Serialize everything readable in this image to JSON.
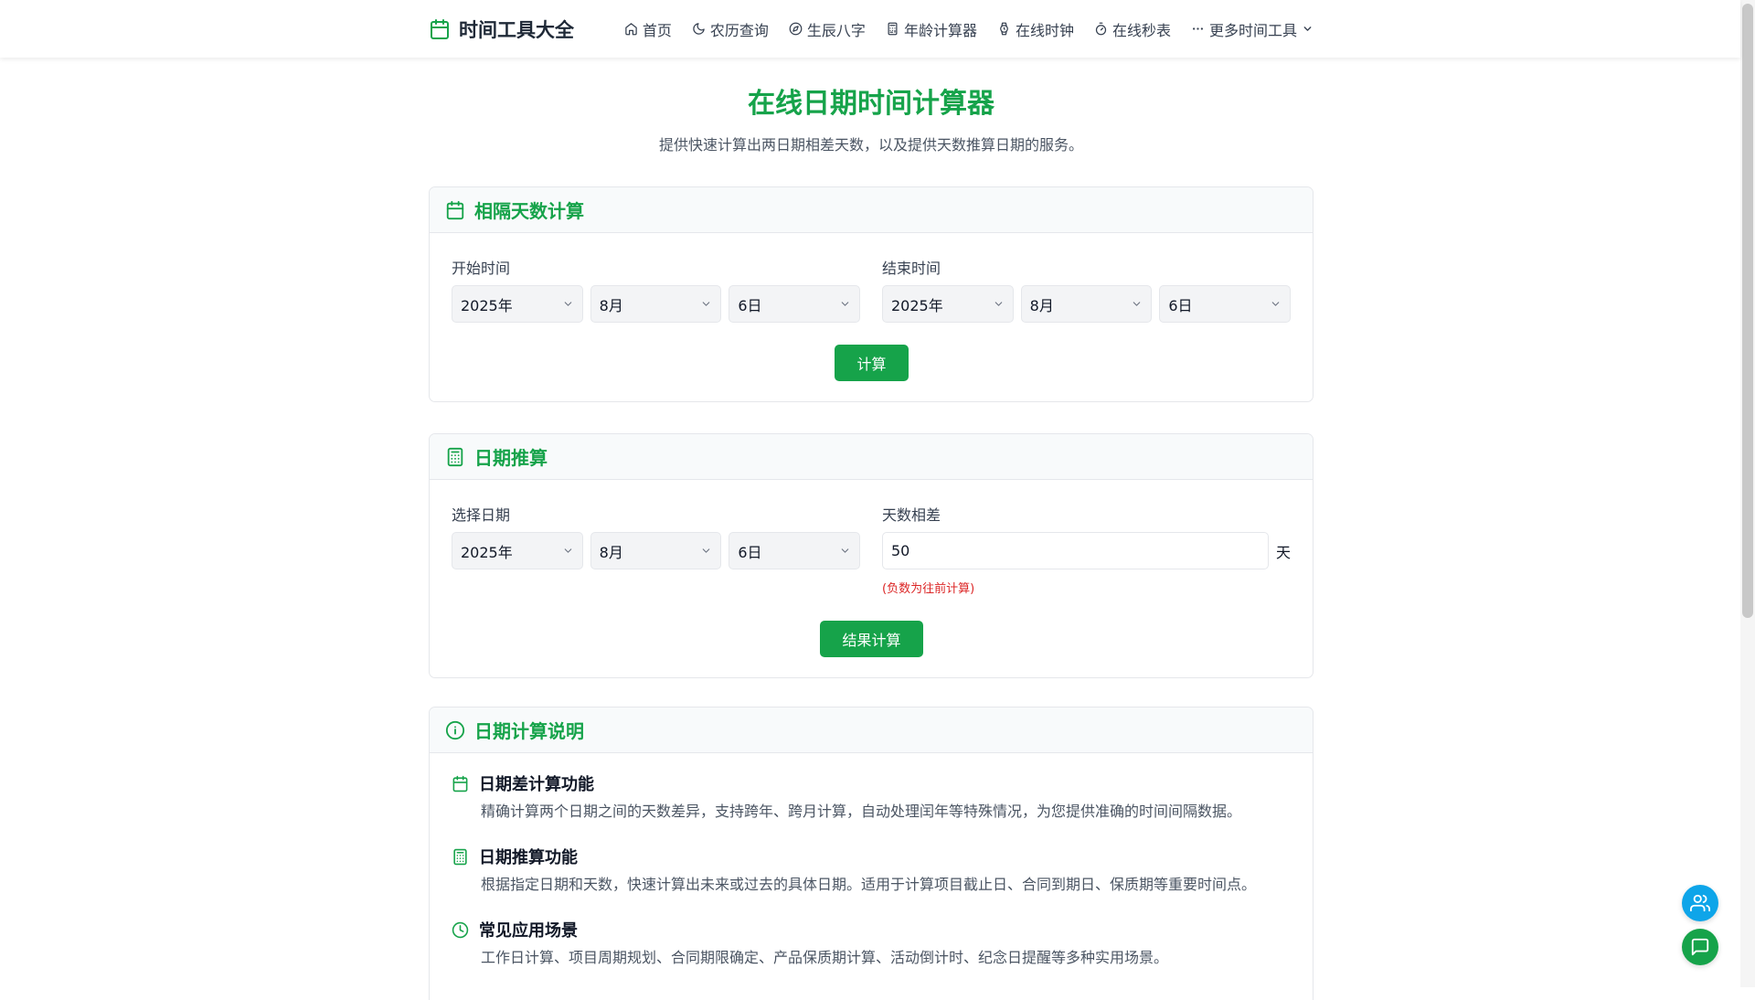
{
  "header": {
    "brand": "时间工具大全",
    "nav": [
      {
        "label": "首页",
        "icon": "home-icon"
      },
      {
        "label": "农历查询",
        "icon": "moon-icon"
      },
      {
        "label": "生辰八字",
        "icon": "compass-icon"
      },
      {
        "label": "年龄计算器",
        "icon": "calculator-icon"
      },
      {
        "label": "在线时钟",
        "icon": "watch-icon"
      },
      {
        "label": "在线秒表",
        "icon": "stopwatch-icon"
      }
    ],
    "more": "更多时间工具"
  },
  "page": {
    "title": "在线日期时间计算器",
    "subtitle": "提供快速计算出两日期相差天数，以及提供天数推算日期的服务。"
  },
  "diff_card": {
    "title": "相隔天数计算",
    "start_label": "开始时间",
    "start": {
      "year": "2025年",
      "month": "8月",
      "day": "6日"
    },
    "end_label": "结束时间",
    "end": {
      "year": "2025年",
      "month": "8月",
      "day": "6日"
    },
    "button": "计算"
  },
  "infer_card": {
    "title": "日期推算",
    "date_label": "选择日期",
    "date": {
      "year": "2025年",
      "month": "8月",
      "day": "6日"
    },
    "days_label": "天数相差",
    "days_value": "50",
    "unit": "天",
    "hint": "(负数为往前计算)",
    "button": "结果计算"
  },
  "info_card": {
    "title": "日期计算说明",
    "items": [
      {
        "title": "日期差计算功能",
        "desc": "精确计算两个日期之间的天数差异，支持跨年、跨月计算，自动处理闰年等特殊情况，为您提供准确的时间间隔数据。"
      },
      {
        "title": "日期推算功能",
        "desc": "根据指定日期和天数，快速计算出未来或过去的具体日期。适用于计算项目截止日、合同到期日、保质期等重要时间点。"
      },
      {
        "title": "常见应用场景",
        "desc": "工作日计算、项目周期规划、合同期限确定、产品保质期计算、活动倒计时、纪念日提醒等多种实用场景。"
      }
    ]
  },
  "colors": {
    "accent": "#16a34a",
    "danger": "#dc2626",
    "fab_blue": "#0ea5e9"
  }
}
